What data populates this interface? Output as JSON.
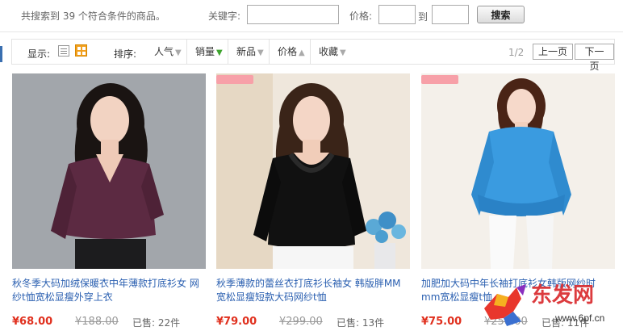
{
  "search": {
    "result_text": "共搜索到 39 个符合条件的商品。",
    "keyword_label": "关键字:",
    "keyword_value": "",
    "price_label": "价格:",
    "price_min": "",
    "to_label": "到",
    "price_max": "",
    "button_label": "搜索"
  },
  "toolbar": {
    "display_label": "显示:",
    "sort_label": "排序:",
    "sort_items": [
      {
        "label": "人气",
        "arrow": "down"
      },
      {
        "label": "销量",
        "arrow": "down",
        "active": true
      },
      {
        "label": "新品",
        "arrow": "down"
      },
      {
        "label": "价格",
        "arrow": "up"
      },
      {
        "label": "收藏",
        "arrow": "down"
      }
    ],
    "page_indicator": "1/2",
    "prev_label": "上一页",
    "next_label": "下一页"
  },
  "products": [
    {
      "title_line1": "秋冬季大码加绒保暖衣中年薄款打底衫女 网",
      "title_line2": "纱t恤宽松显瘦外穿上衣",
      "price": "¥68.00",
      "old_price": "¥188.00",
      "sold": "已售: 22件",
      "top_color": "#5c2a42",
      "new_tag": false
    },
    {
      "title_line1": "秋季薄款的蕾丝衣打底衫长袖女 韩版胖MM",
      "title_line2": "宽松显瘦短款大码网纱t恤",
      "price": "¥79.00",
      "old_price": "¥299.00",
      "sold": "已售: 13件",
      "top_color": "#111111",
      "new_tag": true
    },
    {
      "title_line1": "加肥加大码中年长袖打底衫女韩版网纱时",
      "title_line2": "mm宽松显瘦t恤",
      "price": "¥75.00",
      "old_price": "¥258.00",
      "sold": "已售: 11件",
      "top_color": "#3a9be0",
      "new_tag": true
    }
  ],
  "watermark": {
    "brand": "东发网",
    "url": "www.6pf.cn"
  },
  "colors": {
    "accent_blue": "#2a5fb0",
    "price_red": "#e0301e",
    "grid_orange": "#f2a01e"
  }
}
